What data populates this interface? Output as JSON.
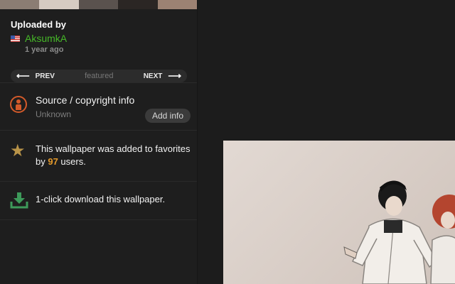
{
  "palette": {
    "colors": [
      "#8b7d73",
      "#d6cbc2",
      "#5a524e",
      "#2b2624",
      "#9c8273"
    ]
  },
  "uploader": {
    "heading": "Uploaded by",
    "username": "AksumkA",
    "flag_icon": "us-flag-icon",
    "time_ago": "1 year ago"
  },
  "nav": {
    "prev_label": "PREV",
    "middle_label": "featured",
    "next_label": "NEXT",
    "prev_icon": "arrow-left-icon",
    "next_icon": "arrow-right-icon"
  },
  "source": {
    "icon": "person-circle-icon",
    "title": "Source / copyright info",
    "value": "Unknown",
    "button_label": "Add info",
    "accent": "#d35a2a"
  },
  "favorites": {
    "icon": "star-icon",
    "text_before": "This wallpaper was added to favorites by ",
    "count": "97",
    "text_after": " users.",
    "count_color": "#e49a2b"
  },
  "download": {
    "icon": "download-icon",
    "text": "1-click download this wallpaper.",
    "accent": "#3d9a5a"
  },
  "colors": {
    "username": "#46b928",
    "background": "#1b1b1b"
  }
}
